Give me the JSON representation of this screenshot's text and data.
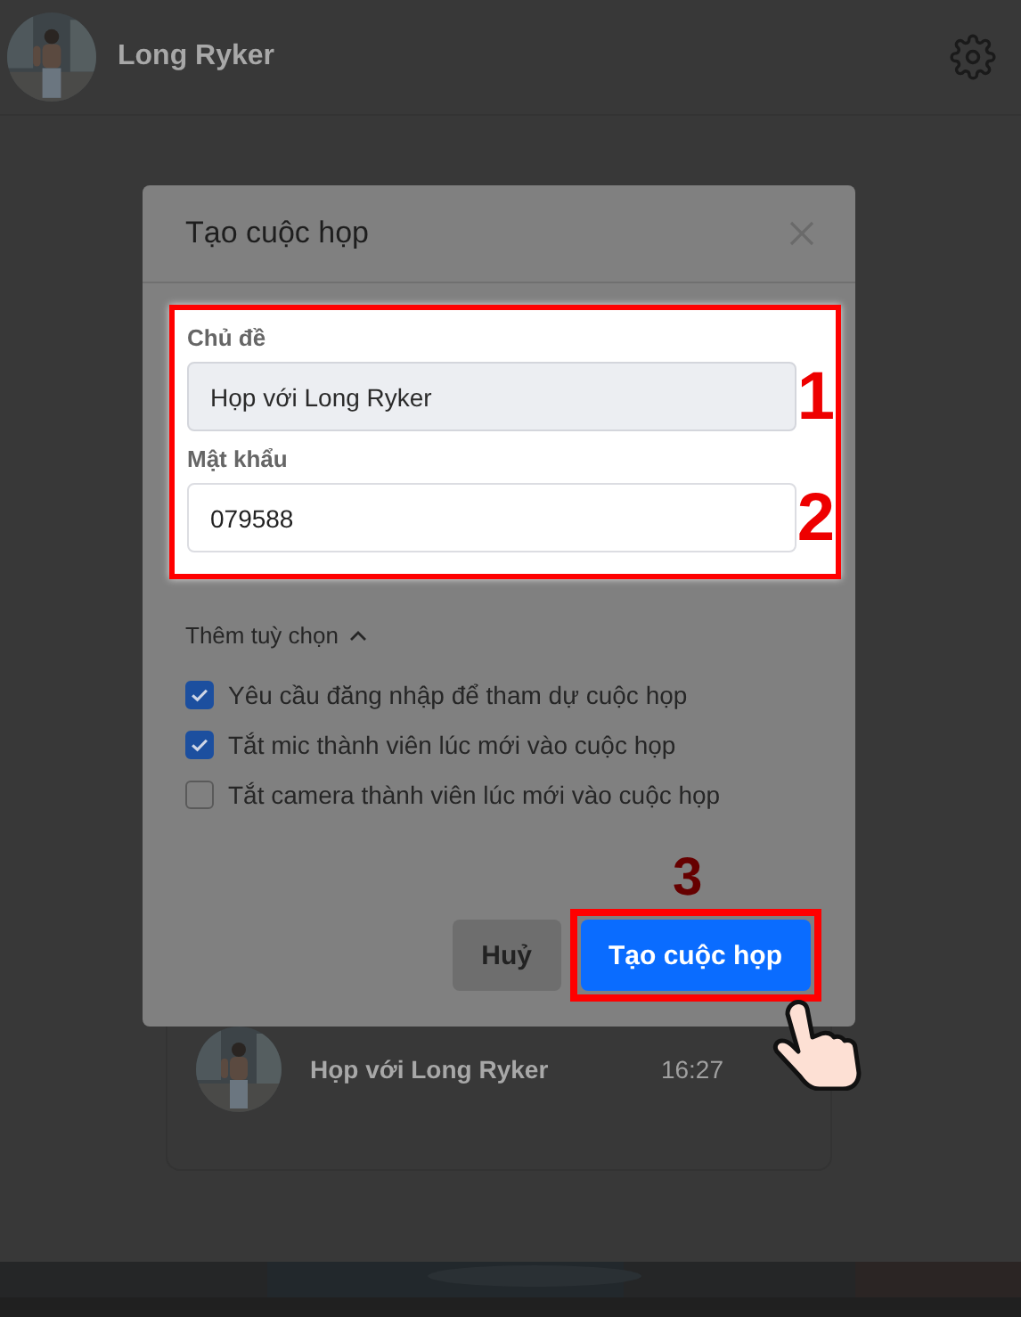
{
  "header": {
    "user_name": "Long Ryker"
  },
  "meetings": [
    {
      "title": "Họp với Long Ryker",
      "time": "16:27"
    }
  ],
  "dialog": {
    "title": "Tạo cuộc họp",
    "fields": [
      {
        "label": "Chủ đề",
        "value": "Họp với Long Ryker",
        "disabled": true,
        "marker": "1"
      },
      {
        "label": "Mật khẩu",
        "value": "079588",
        "disabled": false,
        "marker": "2"
      }
    ],
    "more_options": {
      "label": "Thêm tuỳ chọn",
      "expanded": true
    },
    "options": [
      {
        "label": "Yêu cầu đăng nhập để tham dự cuộc họp",
        "checked": true
      },
      {
        "label": "Tắt mic thành viên lúc mới vào cuộc họp",
        "checked": true
      },
      {
        "label": "Tắt camera thành viên lúc mới vào cuộc họp",
        "checked": false
      }
    ],
    "buttons": [
      {
        "label": "Huỷ",
        "kind": "secondary"
      },
      {
        "label": "Tạo cuộc họp",
        "kind": "primary",
        "marker": "3"
      }
    ]
  }
}
